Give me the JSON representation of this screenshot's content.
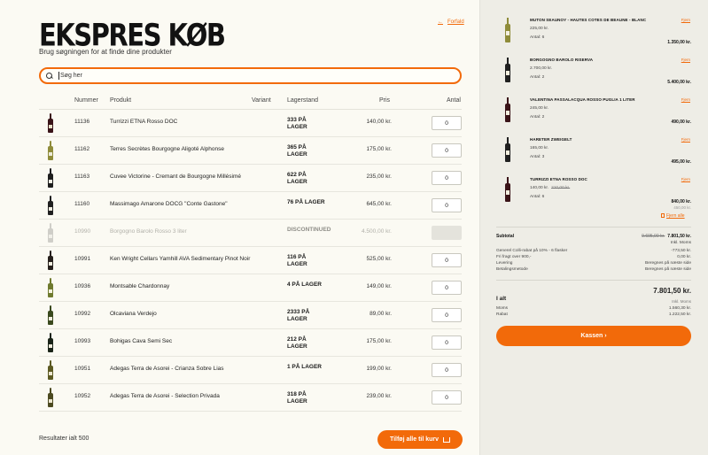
{
  "header": {
    "title": "EKSPRES KØB",
    "subtitle": "Brug søgningen for at finde dine produkter",
    "back_label": "Forfald"
  },
  "search": {
    "placeholder": "Søg her"
  },
  "table": {
    "columns": [
      "Nummer",
      "Produkt",
      "Variant",
      "Lagerstand",
      "Pris",
      "Antal"
    ],
    "rows": [
      {
        "number": "11136",
        "product": "Turrizzi ETNA Rosso DOC",
        "stock": "333 PÅ LAGER",
        "price": "140,00 kr.",
        "qty": "0",
        "bottle_color": "#3a1418",
        "label_color": "#e8e0c8",
        "discontinued": false
      },
      {
        "number": "11162",
        "product": "Terres Secrètes Bourgogne Aligoté Alphonse",
        "stock": "365 PÅ LAGER",
        "price": "175,00 kr.",
        "qty": "0",
        "bottle_color": "#8f8c3a",
        "label_color": "#ecead8",
        "discontinued": false
      },
      {
        "number": "11163",
        "product": "Cuvee Victorine - Cremant de Bourgogne Millésimé",
        "stock": "622 PÅ LAGER",
        "price": "235,00 kr.",
        "qty": "0",
        "bottle_color": "#1e1e1e",
        "label_color": "#f2f0e4",
        "discontinued": false
      },
      {
        "number": "11160",
        "product": "Massimago Amarone DOCG \"Conte Gastone\"",
        "stock": "76 PÅ LAGER",
        "price": "645,00 kr.",
        "qty": "0",
        "bottle_color": "#202020",
        "label_color": "#f0ede0",
        "discontinued": false
      },
      {
        "number": "10990",
        "product": "Borgogno Barolo Rosso 3 liter",
        "stock": "DISCONTINUED",
        "price": "4.500,00 kr.",
        "qty": "",
        "bottle_color": "#cfcec8",
        "label_color": "#f0efe8",
        "discontinued": true
      },
      {
        "number": "10991",
        "product": "Ken Wright Cellars Yamhill AVA Sedimentary Pinot Noir",
        "stock": "116 PÅ LAGER",
        "price": "525,00 kr.",
        "qty": "0",
        "bottle_color": "#26201c",
        "label_color": "#f2efe0",
        "discontinued": false
      },
      {
        "number": "10936",
        "product": "Montsable Chardonnay",
        "stock": "4 PÅ LAGER",
        "price": "149,00 kr.",
        "qty": "0",
        "bottle_color": "#6f7a2e",
        "label_color": "#f5f2e0",
        "discontinued": false
      },
      {
        "number": "10992",
        "product": "Olcaviana Verdejo",
        "stock": "2333 PÅ LAGER",
        "price": "89,00 kr.",
        "qty": "0",
        "bottle_color": "#3b4a1e",
        "label_color": "#f3efe0",
        "discontinued": false
      },
      {
        "number": "10993",
        "product": "Bohigas Cava Semi Sec",
        "stock": "212 PÅ LAGER",
        "price": "175,00 kr.",
        "qty": "0",
        "bottle_color": "#1a2418",
        "label_color": "#efeadb",
        "discontinued": false
      },
      {
        "number": "10951",
        "product": "Adegas Terra de Asorei - Crianza Sobre Lias",
        "stock": "1 PÅ LAGER",
        "price": "199,00 kr.",
        "qty": "0",
        "bottle_color": "#5c5a22",
        "label_color": "#ece6cf",
        "discontinued": false
      },
      {
        "number": "10952",
        "product": "Adegas Terra de Asorei - Selection Privada",
        "stock": "318 PÅ LAGER",
        "price": "239,00 kr.",
        "qty": "0",
        "bottle_color": "#4c4a20",
        "label_color": "#ece6cf",
        "discontinued": false
      }
    ]
  },
  "footer": {
    "results_label": "Resultater ialt 500",
    "add_all_label": "Tilføj alle til kurv"
  },
  "cart": {
    "remove_label": "Fjern",
    "qty_prefix": "Antal:",
    "items": [
      {
        "name": "MUTON SEAUNOY - HAUTES COTES DE BEAUNE - BLANC",
        "unit_price": "225,00 kr.",
        "old_price": "",
        "qty": "6",
        "total": "1.350,00 kr.",
        "extra": "",
        "bottle_color": "#8f8c3a"
      },
      {
        "name": "BORGOGNO BAROLO RISERVA",
        "unit_price": "2.700,00 kr.",
        "old_price": "",
        "qty": "2",
        "total": "5.400,00 kr.",
        "extra": "",
        "bottle_color": "#202020"
      },
      {
        "name": "VALENTINA PASSALACQUA ROSSO PUGLIA 1 LITER",
        "unit_price": "245,00 kr.",
        "old_price": "",
        "qty": "2",
        "total": "490,00 kr.",
        "extra": "",
        "bottle_color": "#3a1418"
      },
      {
        "name": "HARETER ZWEIGELT",
        "unit_price": "165,00 kr.",
        "old_price": "",
        "qty": "3",
        "total": "495,00 kr.",
        "extra": "",
        "bottle_color": "#202020"
      },
      {
        "name": "TURRIZZI ETNA ROSSO DOC",
        "unit_price": "140,00 kr.",
        "old_price": "210,00 kr.",
        "qty": "6",
        "total": "840,00 kr.",
        "extra": "450,00 kr.",
        "bottle_color": "#3a1418"
      }
    ],
    "remove_all_label": "Fjern alle"
  },
  "summary": {
    "subtotal_label": "Subtotal",
    "subtotal_old": "9.695,00 kr.",
    "subtotal_value": "7.801,50 kr.",
    "incl_vat_label": "Inkl. Moms",
    "lines": [
      {
        "label": "Generel Colli-rabat på 10% - 6 flasker",
        "value": "-773,50 kr."
      },
      {
        "label": "Fri fragt over 900,-",
        "value": "0,00 kr."
      },
      {
        "label": "Levering",
        "value": "Beregnes på næste side"
      },
      {
        "label": "Betalingsmetode",
        "value": "Beregnes på næste side"
      }
    ],
    "total_label": "I alt",
    "total_value": "7.801,50 kr.",
    "total_vat_label": "Inkl. Moms",
    "tax_lines": [
      {
        "label": "Moms",
        "value": "1.560,30 kr."
      },
      {
        "label": "Rabat",
        "value": "1.222,50 kr."
      }
    ],
    "checkout_label": "Kassen ›"
  },
  "colors": {
    "accent": "#f26a0a",
    "sidebar_bg": "#eeede6",
    "page_bg": "#fbfaf3"
  }
}
